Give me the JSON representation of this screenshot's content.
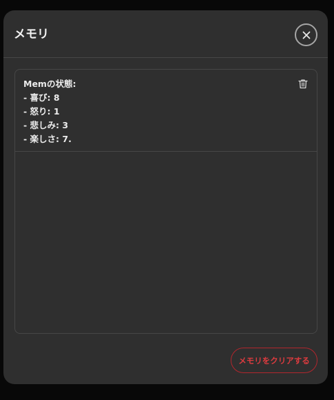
{
  "modal": {
    "title": "メモリ",
    "close_icon": "close-icon"
  },
  "memories": [
    {
      "text": "Memの状態:\n- 喜び: 8\n- 怒り: 1\n- 悲しみ: 3\n- 楽しさ: 7.",
      "delete_icon": "trash-icon"
    }
  ],
  "footer": {
    "clear_label": "メモリをクリアする"
  },
  "colors": {
    "background": "#080808",
    "modal": "#2f2f2f",
    "border": "#474747",
    "text": "#ececec",
    "danger": "#dc3b3f"
  }
}
